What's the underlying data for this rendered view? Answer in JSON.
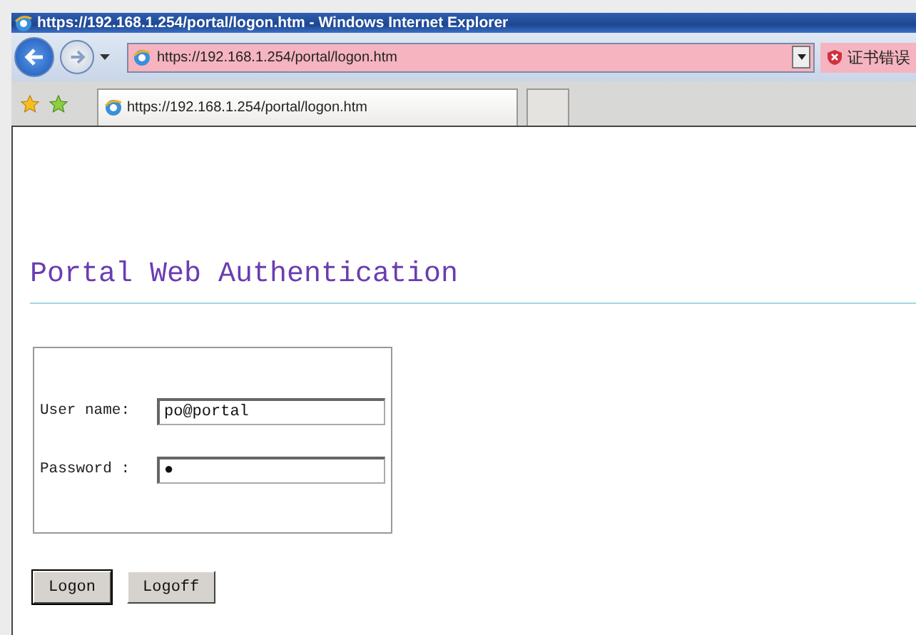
{
  "window": {
    "title": "https://192.168.1.254/portal/logon.htm - Windows Internet Explorer"
  },
  "address_bar": {
    "value": "https://192.168.1.254/portal/logon.htm",
    "certificate_error": true,
    "certificate_label": "证书错误"
  },
  "tabs": [
    {
      "label": "https://192.168.1.254/portal/logon.htm",
      "selected": true
    }
  ],
  "page": {
    "heading": "Portal Web Authentication",
    "form": {
      "fields": [
        {
          "label": "User name:",
          "value": "po@portal"
        },
        {
          "label": "Password :",
          "value": "●"
        }
      ]
    },
    "buttons": [
      {
        "label": "Logon",
        "focused": true
      },
      {
        "label": "Logoff",
        "focused": false
      }
    ]
  }
}
